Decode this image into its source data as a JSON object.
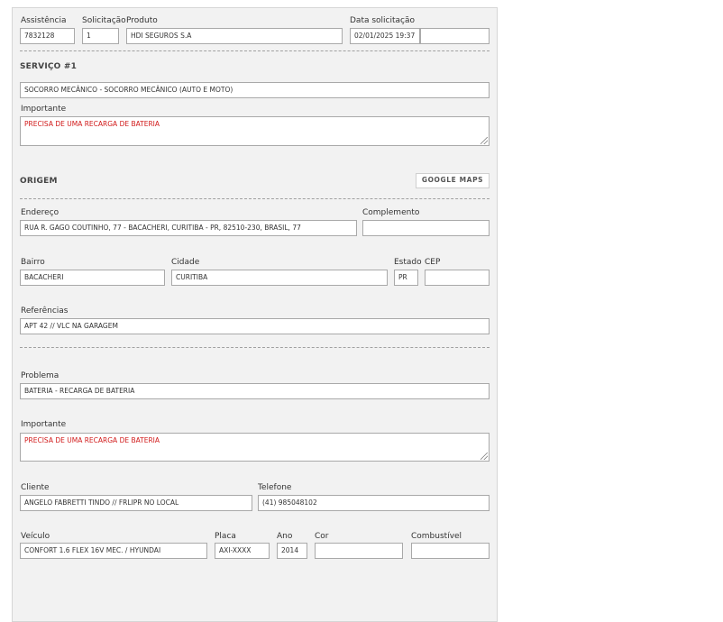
{
  "header": {
    "assistencia_label": "Assistência",
    "assistencia_value": "7832128",
    "solicitacao_label": "Solicitação",
    "solicitacao_value": "1",
    "produto_label": "Produto",
    "produto_value": "HDI SEGUROS S.A",
    "data_label": "Data solicitação",
    "data_value": "02/01/2025 19:37",
    "extra_value": ""
  },
  "servico": {
    "title": "SERVIÇO #1",
    "service_value": "SOCORRO MECÂNICO - SOCORRO MECÂNICO (AUTO E MOTO)",
    "importante_label": "Importante",
    "importante_value": "PRECISA DE UMA RECARGA DE BATERIA"
  },
  "origem": {
    "title": "ORIGEM",
    "maps_button": "GOOGLE MAPS",
    "endereco_label": "Endereço",
    "endereco_value": "RUA R. GAGO COUTINHO, 77 - BACACHERI, CURITIBA - PR, 82510-230, BRASIL, 77",
    "complemento_label": "Complemento",
    "complemento_value": "",
    "bairro_label": "Bairro",
    "bairro_value": "BACACHERI",
    "cidade_label": "Cidade",
    "cidade_value": "CURITIBA",
    "estado_label": "Estado",
    "estado_value": "PR",
    "cep_label": "CEP",
    "cep_value": "",
    "referencias_label": "Referências",
    "referencias_value": "APT 42 // VLC NA GARAGEM"
  },
  "detalhes": {
    "problema_label": "Problema",
    "problema_value": "BATERIA - RECARGA DE BATERIA",
    "importante_label": "Importante",
    "importante_value": "PRECISA DE UMA RECARGA DE BATERIA",
    "cliente_label": "Cliente",
    "cliente_value": "ANGELO FABRETTI TINDO // FRLIPR NO LOCAL",
    "telefone_label": "Telefone",
    "telefone_value": "(41) 985048102",
    "veiculo_label": "Veículo",
    "veiculo_value": "CONFORT 1.6 FLEX 16V MEC. / HYUNDAI",
    "placa_label": "Placa",
    "placa_value": "AXI-XXXX",
    "ano_label": "Ano",
    "ano_value": "2014",
    "cor_label": "Cor",
    "cor_value": "",
    "combustivel_label": "Combustível",
    "combustivel_value": ""
  },
  "colors": {
    "panel_bg": "#f2f2f2",
    "important_text": "#d11a1a",
    "field_border": "#a9a9a9"
  }
}
